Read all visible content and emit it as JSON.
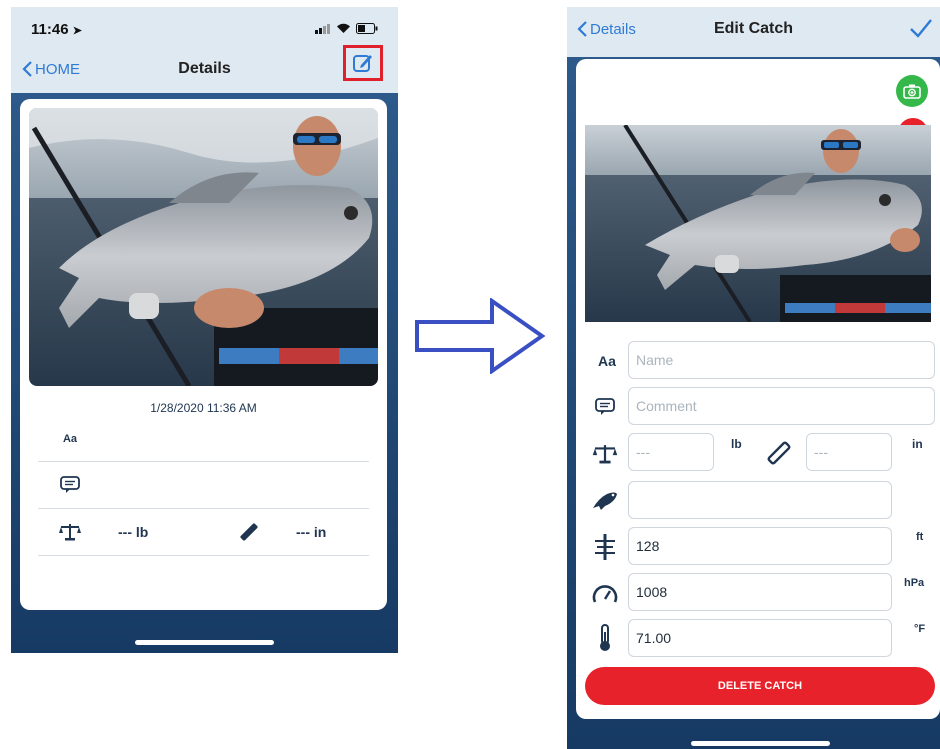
{
  "left": {
    "status_time": "11:46",
    "nav_back": "HOME",
    "nav_title": "Details",
    "edit_icon": "edit-icon",
    "highlight_color": "#e0202a",
    "date": "1/28/2020 11:36 AM",
    "name_icon": "Aa",
    "weight": "--- lb",
    "length": "--- in"
  },
  "arrow_color": "#3a4fc2",
  "right": {
    "nav_back": "Details",
    "nav_title": "Edit Catch",
    "name_placeholder": "Name",
    "comment_placeholder": "Comment",
    "name_icon": "Aa",
    "weight_placeholder": "---",
    "weight_unit": "lb",
    "length_placeholder": "---",
    "length_unit": "in",
    "species_value": "",
    "depth_value": "128",
    "depth_unit": "ft",
    "pressure_value": "1008",
    "pressure_unit": "hPa",
    "temp_value": "71.00",
    "temp_unit": "°F",
    "delete_label": "DELETE CATCH",
    "delete_color": "#e8222b",
    "add_photo_color": "#35b84a"
  }
}
